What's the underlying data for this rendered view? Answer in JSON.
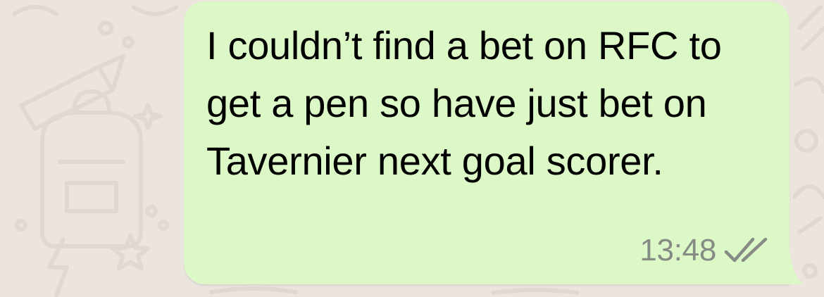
{
  "chat": {
    "message": {
      "text": "I couldn’t find a bet on RFC to get a pen so have just bet on Tavernier next goal scorer.",
      "time": "13:48",
      "status_icon": "double-check-icon",
      "bubble_color": "#dcf8c6",
      "tick_color": "#868b86"
    },
    "wallpaper_color": "#ebe5de"
  }
}
